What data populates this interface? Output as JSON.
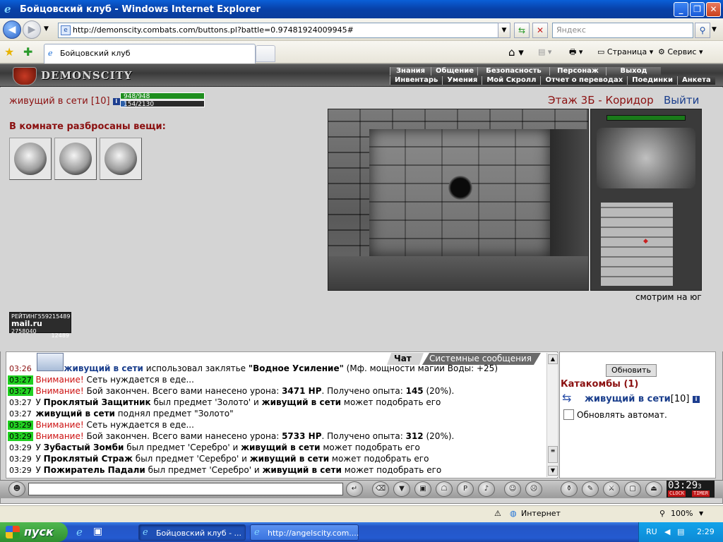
{
  "window": {
    "title": "Бойцовский клуб - Windows Internet Explorer"
  },
  "browser": {
    "url": "http://demonscity.combats.com/buttons.pl?battle=0.97481924009945#",
    "search_placeholder": "Яндекс",
    "tab_title": "Бойцовский клуб",
    "page_menu": "Страница",
    "tools_menu": "Сервис",
    "status_zone": "Интернет",
    "zoom": "100%"
  },
  "game": {
    "logo": "DEMONSCITY",
    "menu_top": [
      "Знания",
      "Общение",
      "Безопасность",
      "Персонаж",
      "Выход"
    ],
    "menu_bottom": [
      "Инвентарь",
      "Умения",
      "Мой Скролл",
      "Отчет о переводах",
      "Поединки",
      "Анкета"
    ],
    "character": {
      "name": "живущий в сети",
      "level": "[10]",
      "hp": "948/948",
      "mp": "154/2130",
      "mp_fraction": 0.07
    },
    "items_header": "В комнате разбросаны вещи:",
    "items_count": 3,
    "location": "Этаж 3Б - Коридор",
    "exit_label": "Выйти",
    "facing": "смотрим на юг",
    "rating": {
      "title": "РЕЙТИНГ",
      "n1": "559215489",
      "site": "mail.ru",
      "n2": "2758040",
      "n3": "12489"
    }
  },
  "chat": {
    "tabs": [
      "Чат",
      "Системные сообщения"
    ],
    "messages": [
      {
        "time": "03:26",
        "time_style": "pl",
        "parts": [
          {
            "s": "blue",
            "t": "живущий в сети"
          },
          {
            "s": "",
            "t": " использовал заклятье "
          },
          {
            "s": "b",
            "t": "\"Водное Усиление\""
          },
          {
            "s": "",
            "t": " (Мф. мощности магии Воды: +25)"
          }
        ]
      },
      {
        "time": "03:27",
        "time_style": "g",
        "parts": [
          {
            "s": "red",
            "t": "Внимание!"
          },
          {
            "s": "",
            "t": " Сеть нуждается в еде..."
          }
        ]
      },
      {
        "time": "03:27",
        "time_style": "g",
        "parts": [
          {
            "s": "red",
            "t": "Внимание!"
          },
          {
            "s": "",
            "t": " Бой закончен. Всего вами нанесено урона: "
          },
          {
            "s": "b",
            "t": "3471 HP"
          },
          {
            "s": "",
            "t": ". Получено опыта: "
          },
          {
            "s": "b",
            "t": "145"
          },
          {
            "s": "",
            "t": " (20%)."
          }
        ]
      },
      {
        "time": "03:27",
        "time_style": "",
        "parts": [
          {
            "s": "",
            "t": "У "
          },
          {
            "s": "b",
            "t": "Проклятый Защитник"
          },
          {
            "s": "",
            "t": " был предмет 'Золото' и "
          },
          {
            "s": "b",
            "t": "живущий в сети"
          },
          {
            "s": "",
            "t": " может подобрать его"
          }
        ]
      },
      {
        "time": "03:27",
        "time_style": "",
        "parts": [
          {
            "s": "b",
            "t": "живущий в сети"
          },
          {
            "s": "",
            "t": " поднял предмет \"Золото\""
          }
        ]
      },
      {
        "time": "03:29",
        "time_style": "g",
        "parts": [
          {
            "s": "red",
            "t": "Внимание!"
          },
          {
            "s": "",
            "t": " Сеть нуждается в еде..."
          }
        ]
      },
      {
        "time": "03:29",
        "time_style": "g",
        "parts": [
          {
            "s": "red",
            "t": "Внимание!"
          },
          {
            "s": "",
            "t": " Бой закончен. Всего вами нанесено урона: "
          },
          {
            "s": "b",
            "t": "5733 HP"
          },
          {
            "s": "",
            "t": ". Получено опыта: "
          },
          {
            "s": "b",
            "t": "312"
          },
          {
            "s": "",
            "t": " (20%)."
          }
        ]
      },
      {
        "time": "03:29",
        "time_style": "",
        "parts": [
          {
            "s": "",
            "t": "У "
          },
          {
            "s": "b",
            "t": "Зубастый Зомби"
          },
          {
            "s": "",
            "t": " был предмет 'Серебро' и "
          },
          {
            "s": "b",
            "t": "живущий в сети"
          },
          {
            "s": "",
            "t": " может подобрать его"
          }
        ]
      },
      {
        "time": "03:29",
        "time_style": "",
        "parts": [
          {
            "s": "",
            "t": "У "
          },
          {
            "s": "b",
            "t": "Проклятый Страж"
          },
          {
            "s": "",
            "t": " был предмет 'Серебро' и "
          },
          {
            "s": "b",
            "t": "живущий в сети"
          },
          {
            "s": "",
            "t": " может подобрать его"
          }
        ]
      },
      {
        "time": "03:29",
        "time_style": "",
        "parts": [
          {
            "s": "",
            "t": "У "
          },
          {
            "s": "b",
            "t": "Пожиратель Падали"
          },
          {
            "s": "",
            "t": " был предмет 'Серебро' и "
          },
          {
            "s": "b",
            "t": "живущий в сети"
          },
          {
            "s": "",
            "t": " может подобрать его"
          }
        ]
      }
    ]
  },
  "room": {
    "refresh_label": "Обновить",
    "title": "Катакомбы (1)",
    "user": "живущий в сети",
    "user_level": "[10]",
    "auto_refresh_label": "Обновлять автомат."
  },
  "clock": {
    "time": "03:29",
    "seconds": "3",
    "label1": "CLOCK",
    "label2": "TIMER"
  },
  "taskbar": {
    "start": "пуск",
    "task1": "Бойцовский клуб - ...",
    "task2": "http://angelscity.com....",
    "lang": "RU",
    "time": "2:29"
  }
}
